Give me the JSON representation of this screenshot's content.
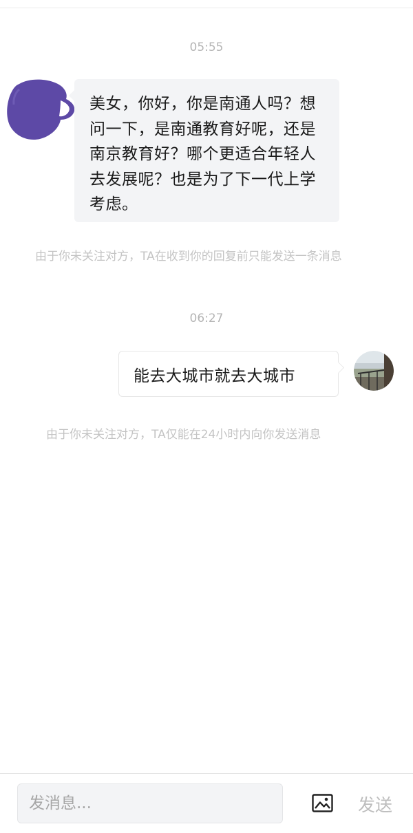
{
  "messages": [
    {
      "timestamp": "05:55",
      "direction": "incoming",
      "text": "美女，你好，你是南通人吗？想问一下，是南通教育好呢，还是南京教育好？哪个更适合年轻人去发展呢？也是为了下一代上学考虑。",
      "notice": "由于你未关注对方，TA在收到你的回复前只能发送一条消息"
    },
    {
      "timestamp": "06:27",
      "direction": "outgoing",
      "text": "能去大城市就去大城市",
      "notice": "由于你未关注对方，TA仅能在24小时内向你发送消息"
    }
  ],
  "composer": {
    "placeholder": "发消息...",
    "image_icon": "image-icon",
    "send_label": "发送"
  },
  "colors": {
    "avatar_scribble": "#5d49a6",
    "incoming_bubble": "#f3f4f6",
    "notice_text": "#c4c4c4",
    "timestamp_text": "#b5b5b5",
    "send_disabled": "#bdbdbd"
  }
}
